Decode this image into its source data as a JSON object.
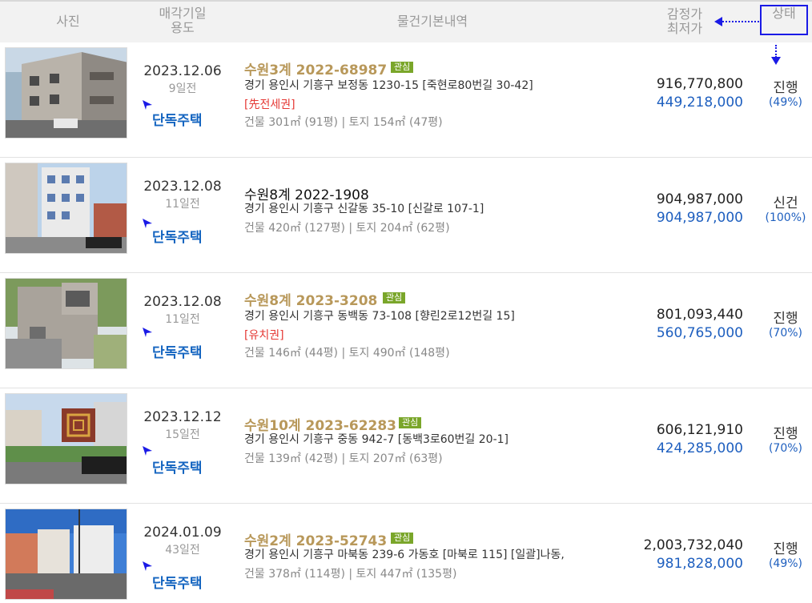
{
  "header": {
    "photo": "사진",
    "date_line1": "매각기일",
    "date_line2": "용도",
    "info": "물건기본내역",
    "price_line1": "감정가",
    "price_line2": "최저가",
    "status": "상태"
  },
  "colors": {
    "accent": "#1a1ae6",
    "fav_case": "#b8985a",
    "min_price": "#1e5fbf",
    "badge": "#7aa62a",
    "right_note": "#e53935"
  },
  "rows": [
    {
      "date": "2023.12.06",
      "days_left": "9일전",
      "usage": "단독주택",
      "case": "수원3계 2022-68987",
      "favorite": true,
      "badge": "관심",
      "address": "경기 용인시 기흥구 보정동 1230-15 [죽현로80번길 30-42]",
      "right_note": "[先전세권]",
      "size": "건물 301㎡ (91평)   |   토지 154㎡ (47평)",
      "appraisal": "916,770,800",
      "minimum": "449,218,000",
      "status": "진행",
      "percent": "(49%)"
    },
    {
      "date": "2023.12.08",
      "days_left": "11일전",
      "usage": "단독주택",
      "case": "수원8계 2022-1908",
      "favorite": false,
      "badge": "",
      "address": "경기 용인시 기흥구 신갈동 35-10 [신갈로 107-1]",
      "right_note": "",
      "size": "건물 420㎡ (127평)   |   토지 204㎡ (62평)",
      "appraisal": "904,987,000",
      "minimum": "904,987,000",
      "status": "신건",
      "percent": "(100%)"
    },
    {
      "date": "2023.12.08",
      "days_left": "11일전",
      "usage": "단독주택",
      "case": "수원8계 2023-3208",
      "favorite": true,
      "badge": "관심",
      "address": "경기 용인시 기흥구 동백동 73-108 [향린2로12번길 15]",
      "right_note": "[유치권]",
      "size": "건물 146㎡ (44평)   |   토지 490㎡ (148평)",
      "appraisal": "801,093,440",
      "minimum": "560,765,000",
      "status": "진행",
      "percent": "(70%)"
    },
    {
      "date": "2023.12.12",
      "days_left": "15일전",
      "usage": "단독주택",
      "case": "수원10계 2023-62283",
      "favorite": true,
      "badge": "관심",
      "address": "경기 용인시 기흥구 중동 942-7 [동백3로60번길 20-1]",
      "right_note": "",
      "size": "건물 139㎡ (42평)   |   토지 207㎡ (63평)",
      "appraisal": "606,121,910",
      "minimum": "424,285,000",
      "status": "진행",
      "percent": "(70%)"
    },
    {
      "date": "2024.01.09",
      "days_left": "43일전",
      "usage": "단독주택",
      "case": "수원2계 2023-52743",
      "favorite": true,
      "badge": "관심",
      "address": "경기 용인시 기흥구 마북동 239-6 가동호 [마북로 115]  [일괄]나동,",
      "right_note": "",
      "size": "건물 378㎡ (114평)   |   토지 447㎡ (135평)",
      "appraisal": "2,003,732,040",
      "minimum": "981,828,000",
      "status": "진행",
      "percent": "(49%)"
    }
  ]
}
